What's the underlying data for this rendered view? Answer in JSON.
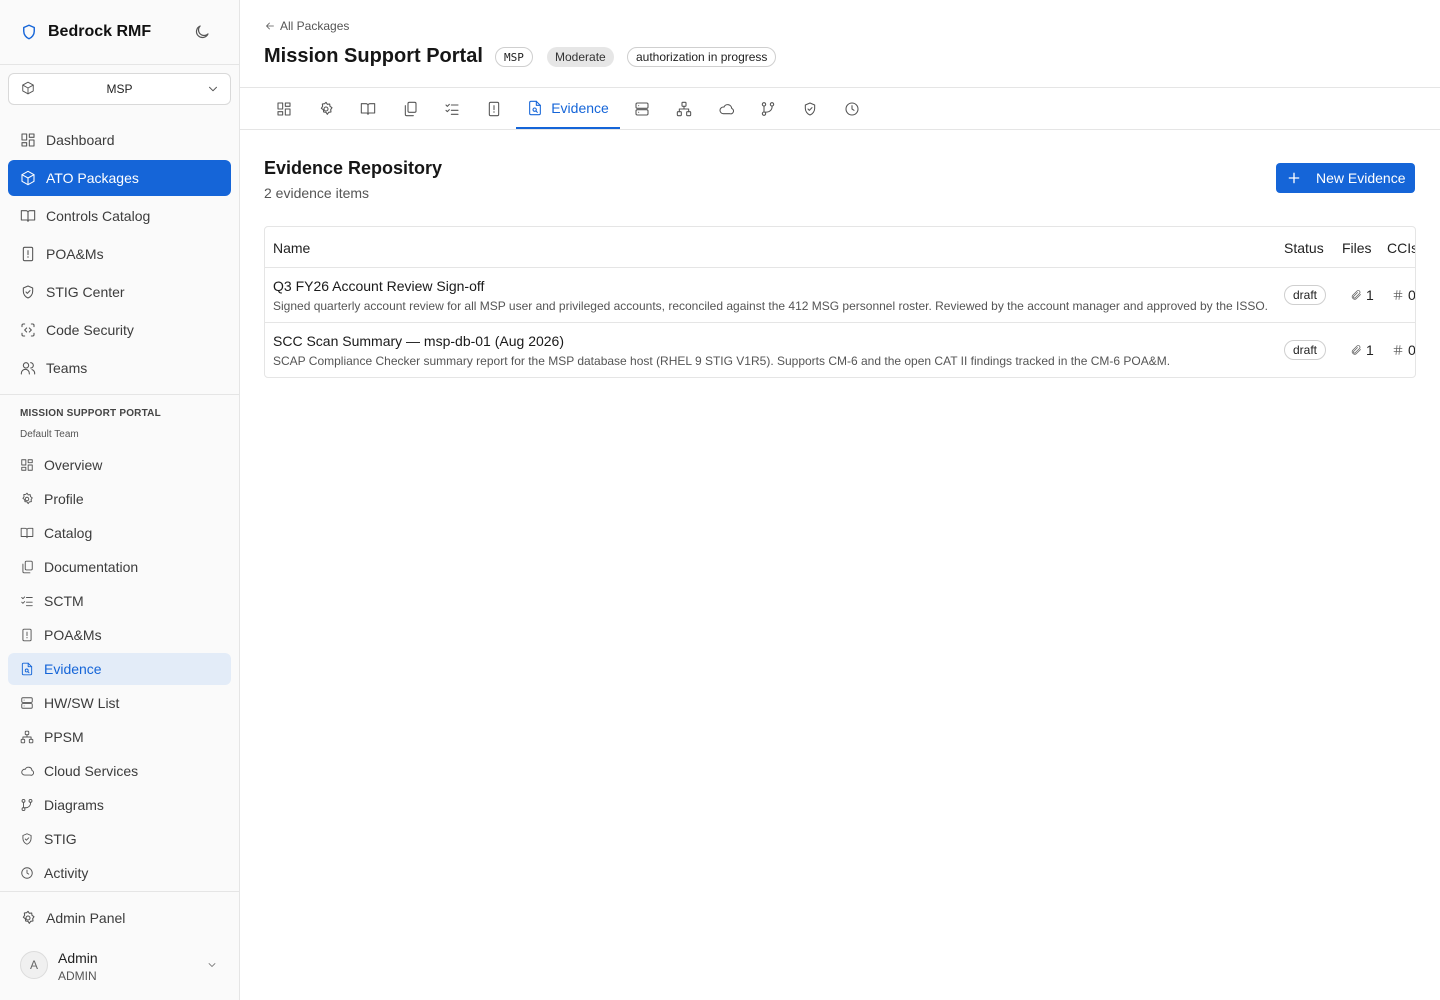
{
  "app": {
    "name": "Bedrock RMF"
  },
  "package_selector": {
    "value": "MSP"
  },
  "nav": [
    {
      "label": "Dashboard",
      "icon": "dashboard-icon"
    },
    {
      "label": "ATO Packages",
      "icon": "package-icon",
      "active": true
    },
    {
      "label": "Controls Catalog",
      "icon": "book-icon"
    },
    {
      "label": "POA&Ms",
      "icon": "file-alert-icon"
    },
    {
      "label": "STIG Center",
      "icon": "shield-check-icon"
    },
    {
      "label": "Code Security",
      "icon": "scan-code-icon"
    },
    {
      "label": "Teams",
      "icon": "users-icon"
    }
  ],
  "package_section": {
    "title": "MISSION SUPPORT PORTAL",
    "team": "Default Team",
    "items": [
      {
        "label": "Overview",
        "icon": "dashboard-icon"
      },
      {
        "label": "Profile",
        "icon": "gear-icon"
      },
      {
        "label": "Catalog",
        "icon": "book-icon"
      },
      {
        "label": "Documentation",
        "icon": "documents-icon"
      },
      {
        "label": "SCTM",
        "icon": "checklist-icon"
      },
      {
        "label": "POA&Ms",
        "icon": "file-alert-icon"
      },
      {
        "label": "Evidence",
        "icon": "file-search-icon",
        "active": true
      },
      {
        "label": "HW/SW List",
        "icon": "server-icon"
      },
      {
        "label": "PPSM",
        "icon": "network-icon"
      },
      {
        "label": "Cloud Services",
        "icon": "cloud-icon"
      },
      {
        "label": "Diagrams",
        "icon": "branch-icon"
      },
      {
        "label": "STIG",
        "icon": "shield-check-icon"
      },
      {
        "label": "Activity",
        "icon": "clock-icon"
      }
    ]
  },
  "admin_panel": {
    "label": "Admin Panel"
  },
  "user": {
    "initial": "A",
    "name": "Admin",
    "role": "ADMIN"
  },
  "header": {
    "back_label": "All Packages",
    "title": "Mission Support Portal",
    "code_badge": "MSP",
    "level_badge": "Moderate",
    "status_badge": "authorization in progress"
  },
  "tabs": {
    "active_label": "Evidence"
  },
  "evidence": {
    "title": "Evidence Repository",
    "count_text": "2 evidence items",
    "new_button": "New Evidence",
    "columns": {
      "name": "Name",
      "status": "Status",
      "files": "Files",
      "ccis": "CCIs"
    },
    "rows": [
      {
        "title": "Q3 FY26 Account Review Sign-off",
        "description": "Signed quarterly account review for all MSP user and privileged accounts, reconciled against the 412 MSG personnel roster. Reviewed by the account manager and approved by the ISSO.",
        "status": "draft",
        "files": "1",
        "ccis": "0"
      },
      {
        "title": "SCC Scan Summary — msp-db-01 (Aug 2026)",
        "description": "SCAP Compliance Checker summary report for the MSP database host (RHEL 9 STIG V1R5). Supports CM-6 and the open CAT II findings tracked in the CM-6 POA&M.",
        "status": "draft",
        "files": "1",
        "ccis": "0"
      }
    ]
  },
  "colors": {
    "accent": "#1565d8",
    "accent_light": "#e3ecf8",
    "border": "#e5e5e5"
  }
}
